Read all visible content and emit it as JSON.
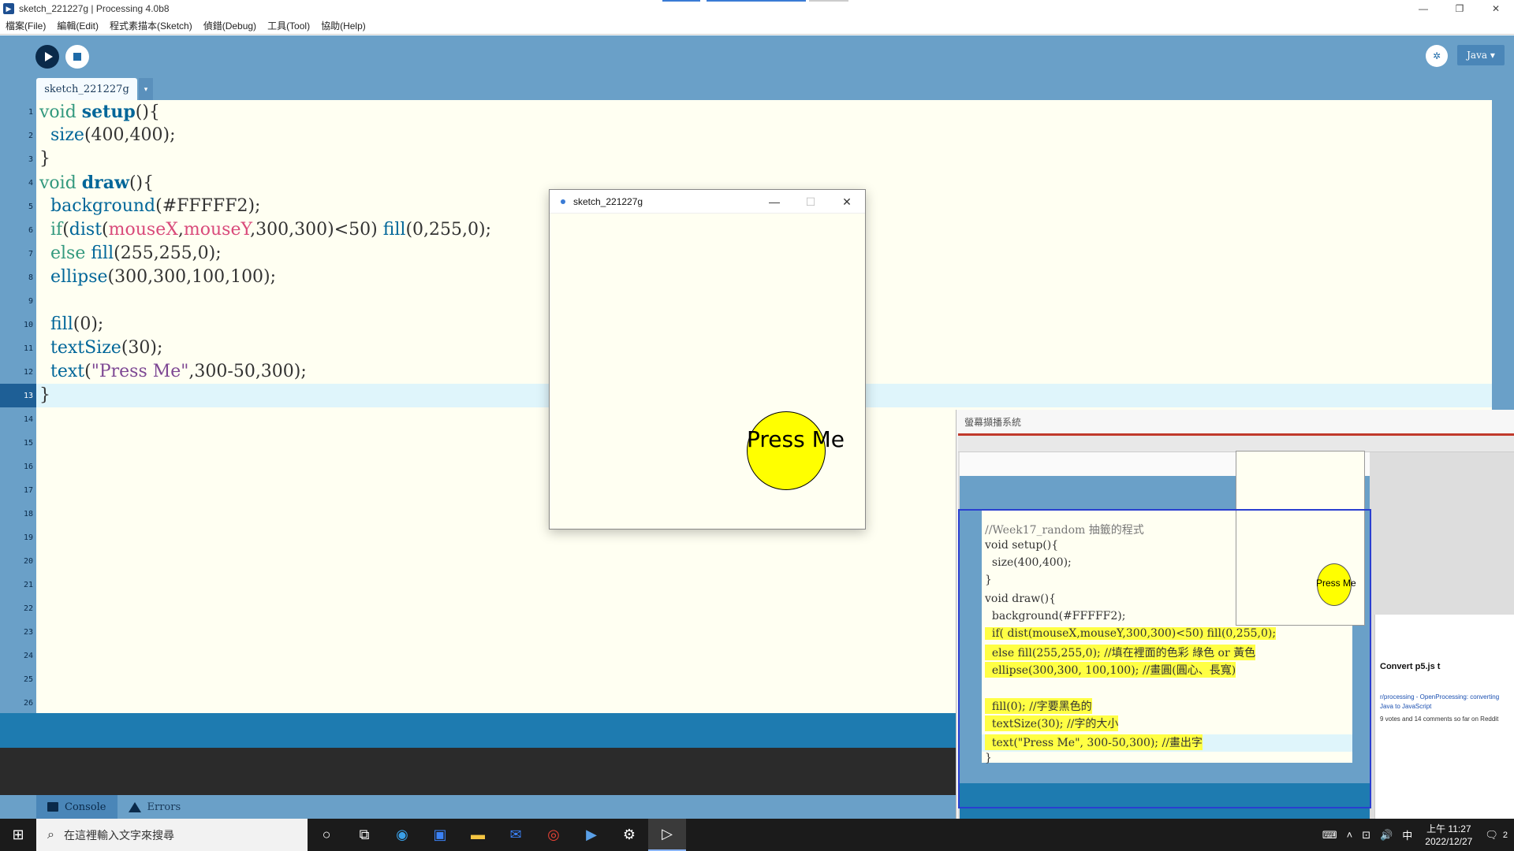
{
  "window": {
    "title": "sketch_221227g | Processing 4.0b8",
    "controls": [
      "—",
      "❐",
      "✕"
    ]
  },
  "menu": [
    "檔案(File)",
    "編輯(Edit)",
    "程式素描本(Sketch)",
    "偵錯(Debug)",
    "工具(Tool)",
    "協助(Help)"
  ],
  "toolbar": {
    "mode_label": "Java ▾",
    "debug_icon": "debug-icon"
  },
  "tab": {
    "label": "sketch_221227g",
    "menu_glyph": "▾"
  },
  "line_numbers": [
    "1",
    "2",
    "3",
    "4",
    "5",
    "6",
    "7",
    "8",
    "9",
    "10",
    "11",
    "12",
    "13",
    "14",
    "15",
    "16",
    "17",
    "18",
    "19",
    "20",
    "21",
    "22",
    "23",
    "24",
    "25",
    "26"
  ],
  "footer": {
    "console_label": "Console",
    "errors_label": "Errors"
  },
  "sketch_window": {
    "title": "sketch_221227g",
    "button_text": "Press Me",
    "controls": [
      "—",
      "☐",
      "✕"
    ],
    "colors": {
      "background": "#FFFFF2",
      "circle": "#FFFF00"
    }
  },
  "recorder": {
    "title": "螢幕擷播系統",
    "code_lines": [
      "//Week17_random 抽籤的程式",
      "void setup(){",
      "  size(400,400);",
      "}",
      "void draw(){",
      "  background(#FFFFF2);",
      "  if( dist(mouseX,mouseY,300,300)<50) fill(0,255,0);",
      "  else fill(255,255,0); //填在裡面的色彩 綠色 or 黃色",
      "  ellipse(300,300, 100,100); //畫圓(圓心、長寬)",
      "",
      "  fill(0); //字要黑色的",
      "  textSize(30); //字的大小",
      "  text(\"Press Me\", 300-50,300); //畫出字",
      "}"
    ],
    "mini_sketch_text": "Press Me",
    "browser": {
      "title": "Convert p5.js t",
      "link": "r/processing - OpenProcessing: converting",
      "link2": "Java to JavaScript",
      "meta": "9 votes and 14 comments so far on Reddit"
    }
  },
  "taskbar": {
    "search_placeholder": "在這裡輸入文字來搜尋",
    "time": "上午 11:27",
    "date": "2022/12/27",
    "ime": "中",
    "notification_count": "2"
  }
}
